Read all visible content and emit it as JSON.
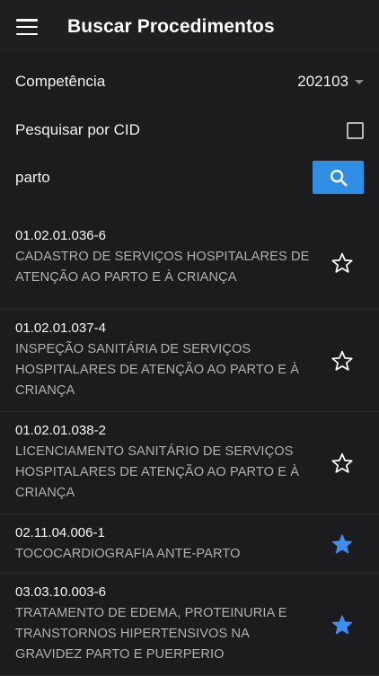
{
  "header": {
    "title": "Buscar Procedimentos"
  },
  "competencia": {
    "label": "Competência",
    "value": "202103"
  },
  "cid": {
    "label": "Pesquisar por CID",
    "checked": false
  },
  "search": {
    "value": "parto"
  },
  "results": [
    {
      "code": "01.02.01.036-6",
      "description": "CADASTRO DE SERVIÇOS HOSPITALARES DE ATENÇÃO AO PARTO E À CRIANÇA",
      "favorite": false
    },
    {
      "code": "01.02.01.037-4",
      "description": "INSPEÇÃO SANITÁRIA DE SERVIÇOS HOSPITALARES DE ATENÇÃO AO PARTO E À CRIANÇA",
      "favorite": false
    },
    {
      "code": "01.02.01.038-2",
      "description": "LICENCIAMENTO SANITÁRIO DE SERVIÇOS HOSPITALARES DE ATENÇÃO AO PARTO E À CRIANÇA",
      "favorite": false
    },
    {
      "code": "02.11.04.006-1",
      "description": "TOCOCARDIOGRAFIA ANTE-PARTO",
      "favorite": true
    },
    {
      "code": "03.03.10.003-6",
      "description": "TRATAMENTO DE EDEMA, PROTEINURIA E TRANSTORNOS HIPERTENSIVOS NA GRAVIDEZ PARTO E PUERPERIO",
      "favorite": true
    }
  ],
  "colors": {
    "accent": "#2f8de4",
    "background": "#1c1c1e",
    "star_outline": "#ffffff",
    "star_filled": "#3d8ef0"
  },
  "icons": {
    "menu": "hamburger-icon",
    "search": "search-icon",
    "favorite": "star-icon"
  }
}
